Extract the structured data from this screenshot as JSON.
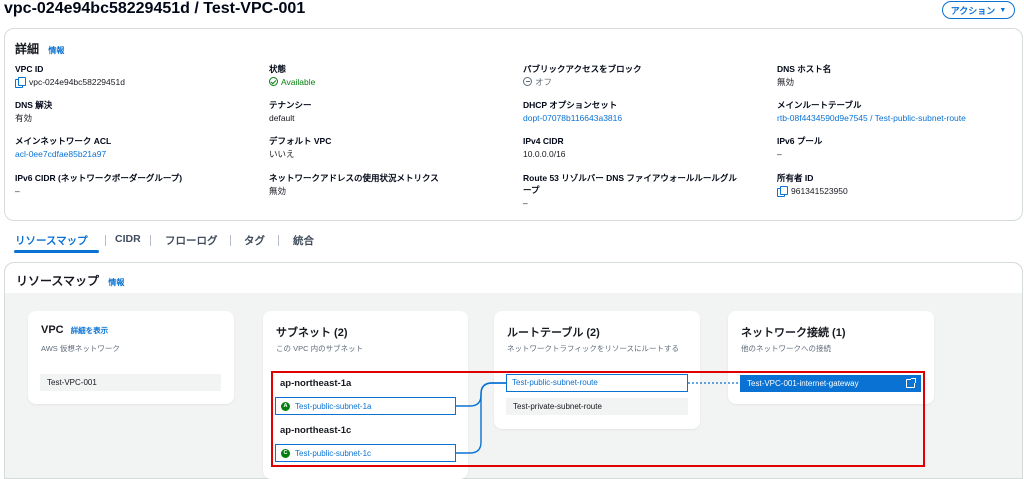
{
  "header": {
    "title": "vpc-024e94bc58229451d / Test-VPC-001",
    "action_label": "アクション",
    "action_caret": "▼"
  },
  "details": {
    "title": "詳細",
    "info": "情報",
    "fields": {
      "vpc_id": {
        "label": "VPC ID",
        "value": "vpc-024e94bc58229451d"
      },
      "status": {
        "label": "状態",
        "value": "Available"
      },
      "public_access": {
        "label": "パブリックアクセスをブロック",
        "value": "オフ"
      },
      "dns_hostname": {
        "label": "DNS ホスト名",
        "value": "無効"
      },
      "dns_resolution": {
        "label": "DNS 解決",
        "value": "有効"
      },
      "tenancy": {
        "label": "テナンシー",
        "value": "default"
      },
      "dhcp": {
        "label": "DHCP オプションセット",
        "value": "dopt-07078b116643a3816"
      },
      "main_route_table": {
        "label": "メインルートテーブル",
        "value": "rtb-08f4434590d9e7545 / Test-public-subnet-route"
      },
      "main_acl": {
        "label": "メインネットワーク ACL",
        "value": "acl-0ee7cdfae85b21a97"
      },
      "default_vpc": {
        "label": "デフォルト VPC",
        "value": "いいえ"
      },
      "ipv4_cidr": {
        "label": "IPv4 CIDR",
        "value": "10.0.0.0/16"
      },
      "ipv6_pool": {
        "label": "IPv6 プール",
        "value": "–"
      },
      "ipv6_cidr": {
        "label": "IPv6 CIDR (ネットワークボーダーグループ)",
        "value": "–"
      },
      "net_metrics": {
        "label": "ネットワークアドレスの使用状況メトリクス",
        "value": "無効"
      },
      "route53_line1": {
        "label": "Route 53 リゾルバー DNS ファイアウォールルールグル"
      },
      "route53_line2": {
        "label": "ープ",
        "value": "–"
      },
      "owner": {
        "label": "所有者 ID",
        "value": "961341523950"
      }
    }
  },
  "tabs": [
    "リソースマップ",
    "CIDR",
    "フローログ",
    "タグ",
    "統合"
  ],
  "resource_map": {
    "title": "リソースマップ",
    "info": "情報",
    "vpc": {
      "title": "VPC",
      "detail_link": "詳細を表示",
      "subtitle": "AWS 仮想ネットワーク",
      "item": "Test-VPC-001"
    },
    "subnets": {
      "title": "サブネット (2)",
      "subtitle": "この VPC 内のサブネット",
      "groups": [
        {
          "az": "ap-northeast-1a",
          "badge": "A",
          "subnet": "Test-public-subnet-1a"
        },
        {
          "az": "ap-northeast-1c",
          "badge": "C",
          "subnet": "Test-public-subnet-1c"
        }
      ]
    },
    "route_tables": {
      "title": "ルートテーブル (2)",
      "subtitle": "ネットワークトラフィックをリソースにルートする",
      "items": [
        "Test-public-subnet-route",
        "Test-private-subnet-route"
      ]
    },
    "network_connections": {
      "title": "ネットワーク接続 (1)",
      "subtitle": "他のネットワークへの接続",
      "items": [
        "Test-VPC-001-internet-gateway"
      ]
    }
  },
  "colors": {
    "accent": "#0972d3",
    "success": "#037f0c",
    "highlight": "#e00000"
  }
}
